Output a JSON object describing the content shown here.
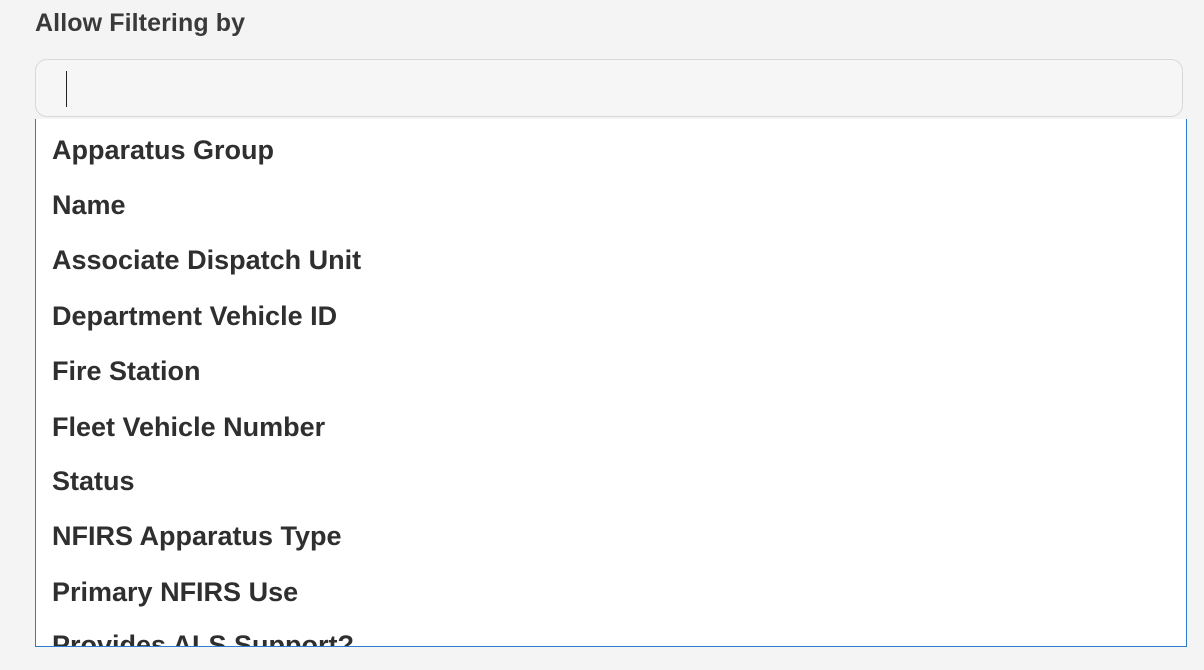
{
  "field": {
    "label": "Allow Filtering by",
    "search_value": "",
    "search_placeholder": ""
  },
  "dropdown": {
    "options": [
      "Apparatus Group",
      "Name",
      "Associate Dispatch Unit",
      "Department Vehicle ID",
      "Fire Station",
      "Fleet Vehicle Number",
      "Status",
      "NFIRS Apparatus Type",
      "Primary NFIRS Use",
      "Provides ALS Support?"
    ]
  },
  "colors": {
    "focus_border": "#2b7bd1",
    "background": "#f4f4f4",
    "text": "#2f2f2f"
  }
}
